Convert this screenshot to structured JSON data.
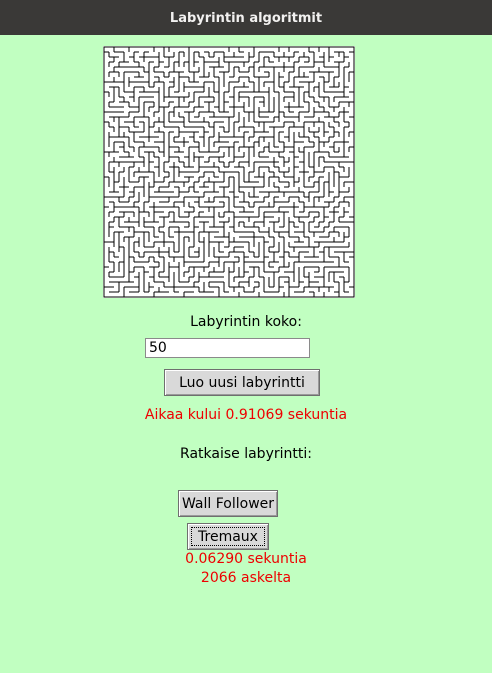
{
  "window": {
    "title": "Labyrintin algoritmit"
  },
  "maze": {
    "size": 50,
    "wall_color": "#000000",
    "background_color": "#ffffff"
  },
  "form": {
    "size_label": "Labyrintin koko:",
    "size_value": "50",
    "create_button": "Luo uusi labyrintti",
    "creation_time_text": "Aikaa kului 0.91069 sekuntia"
  },
  "solve": {
    "heading": "Ratkaise labyrintti:",
    "wall_follower_button": "Wall Follower",
    "tremaux_button": "Tremaux",
    "result_time": "0.06290 sekuntia",
    "result_steps": "2066 askelta"
  },
  "colors": {
    "background": "#c1ffc1",
    "titlebar": "#3a3937",
    "status_text": "#ee0000"
  }
}
